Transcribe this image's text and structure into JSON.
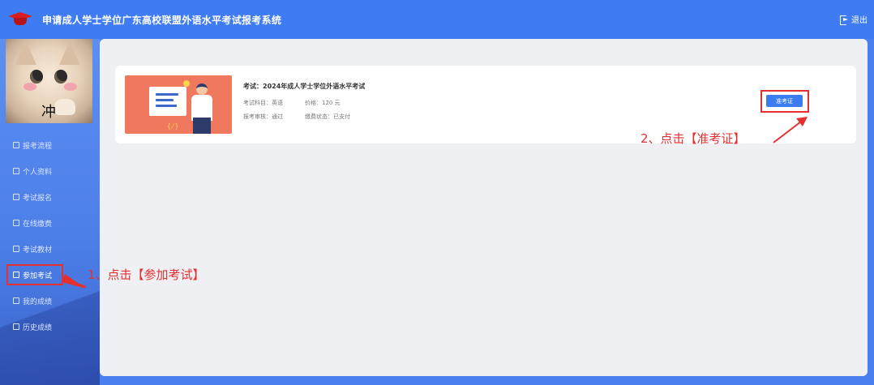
{
  "header": {
    "title": "申请成人学士学位广东高校联盟外语水平考试报考系统",
    "logout_label": "退出",
    "logo_icon": "graduation-cap-icon",
    "background": "#3f7cf3"
  },
  "sidebar": {
    "avatar_text": "冲",
    "items": [
      {
        "label": "报考流程",
        "icon": "edit-icon"
      },
      {
        "label": "个人资料",
        "icon": "user-card-icon"
      },
      {
        "label": "考试报名",
        "icon": "edit-icon"
      },
      {
        "label": "在线缴费",
        "icon": "edit-icon"
      },
      {
        "label": "考试教材",
        "icon": "edit-icon"
      },
      {
        "label": "参加考试",
        "icon": "edit-icon",
        "active": true
      },
      {
        "label": "我的成绩",
        "icon": "edit-icon"
      },
      {
        "label": "历史成绩",
        "icon": "edit-icon"
      }
    ]
  },
  "exam": {
    "title": "考试：2024年成人学士学位外语水平考试",
    "subject": "考试科目：英语",
    "price": "价格：120 元",
    "review": "报考审核：通过",
    "payment": "缴费状态：已支付",
    "ticket_button": "准考证"
  },
  "annotations": {
    "step1": "1、点击【参加考试】",
    "step2": "2、点击【准考证】",
    "color": "#e53030"
  }
}
